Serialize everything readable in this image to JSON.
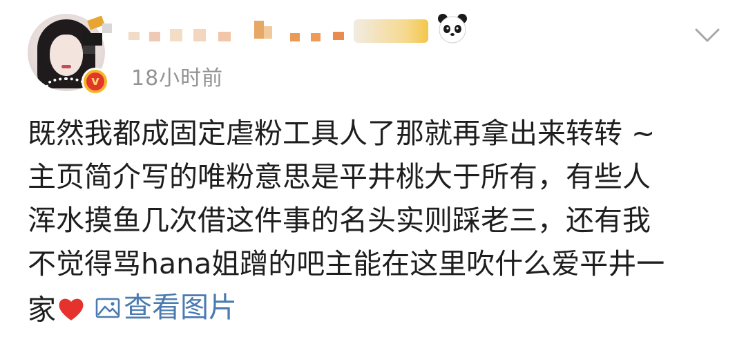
{
  "post": {
    "timestamp": "18小时前",
    "content_lines": [
      "既然我都成固定虐粉工具人了那就再拿出来转转 ~",
      "主页简介写的唯粉意思是平井桃大于所有，有些人",
      "浑水摸鱼几次借这件事的名头实则踩老三，还有我",
      "不觉得骂hana姐蹭的吧主能在这里吹什么爱平井一",
      "家"
    ],
    "view_images_label": "查看图片"
  },
  "colors": {
    "text": "#1e1e1e",
    "muted": "#939393",
    "link": "#4b7bb0",
    "heart": "#e5322d",
    "verify_badge": "#f3b628"
  },
  "icons": [
    "avatar",
    "verified-v-icon",
    "panda-icon",
    "chevron-down-icon",
    "heart-icon",
    "image-icon"
  ]
}
